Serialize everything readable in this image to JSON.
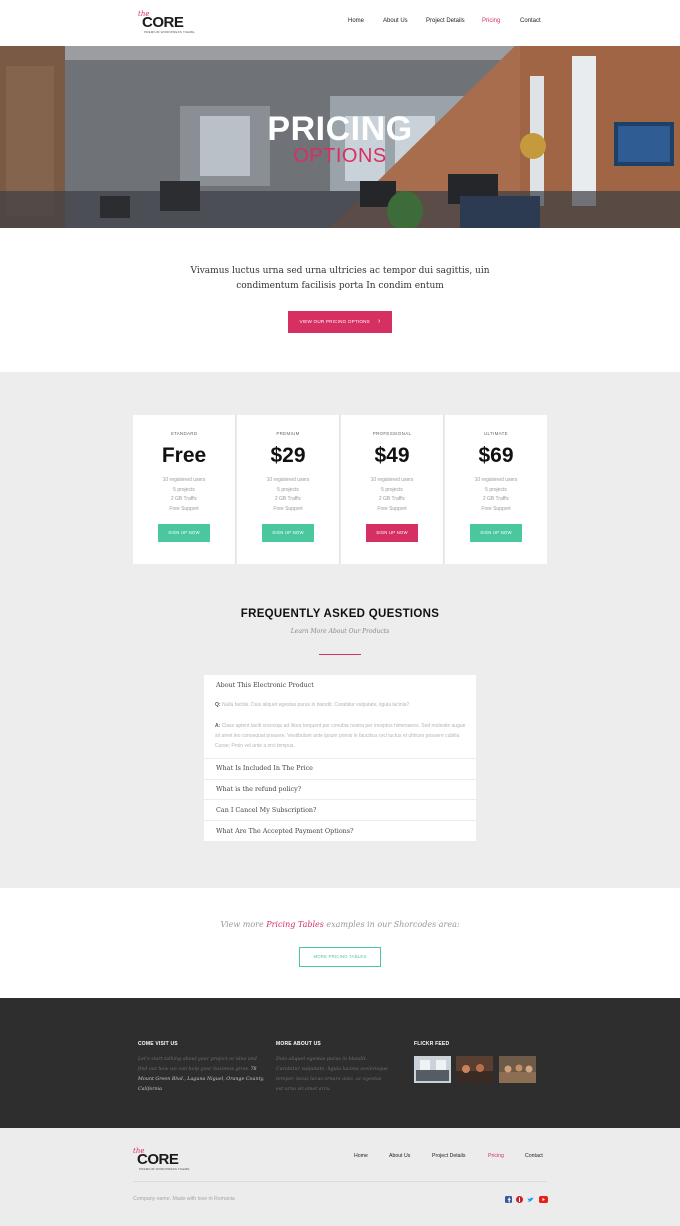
{
  "logo": {
    "prefix": "the",
    "name": "CORE",
    "tagline": "PREMIUM WORDPRESS THEME"
  },
  "nav": {
    "items": [
      "Home",
      "About Us",
      "Project Details",
      "Pricing",
      "Contact"
    ],
    "active": "Pricing"
  },
  "hero": {
    "title": "PRICING",
    "subtitle": "OPTIONS"
  },
  "intro": {
    "text": "Vivamus luctus urna sed urna ultricies ac tempor dui sagittis, uin condimentum facilisis porta In condim entum",
    "button": "VIEW OUR PRICING OPTIONS",
    "button_icon": "chevron-right-icon"
  },
  "plans": [
    {
      "name": "STANDARD",
      "price": "Free",
      "features": [
        "10 registered users",
        "5 projects",
        "2 GB Traffic",
        "Free Support"
      ],
      "button": "SIGN UP NOW",
      "highlight": false
    },
    {
      "name": "PREMIUM",
      "price": "$29",
      "features": [
        "10 registered users",
        "5 projects",
        "2 GB Traffic",
        "Free Support"
      ],
      "button": "SIGN UP NOW",
      "highlight": false
    },
    {
      "name": "PROFESSIONAL",
      "price": "$49",
      "features": [
        "10 registered users",
        "5 projects",
        "2 GB Traffic",
        "Free Support"
      ],
      "button": "SIGN UP NOW",
      "highlight": true
    },
    {
      "name": "ULTIMATE",
      "price": "$69",
      "features": [
        "10 registered users",
        "5 projects",
        "2 GB Traffic",
        "Free Support"
      ],
      "button": "SIGN UP NOW",
      "highlight": false
    }
  ],
  "faq": {
    "title": "FREQUENTLY ASKED QUESTIONS",
    "subtitle": "Learn More About Our Products",
    "open_question": "About This Electronic Product",
    "q_label": "Q:",
    "q_text": "Nulla facilisi. Duis aliquet egestas purus in blandit. Curabitur vulputate, ligula lacinia?",
    "a_label": "A:",
    "a_text": "Class aptent taciti sociosqu ad litora torquent per conubia nostra per inceptos himenaeos. Sed molestie augue sit amet leo consequat posuere. Vestibulum ante ipsum primis in faucibus orci luctus et ultrices posuere cubilia Curae; Proin vel ante a orci tempus.",
    "questions": [
      "What Is Included In The Price",
      "What is the refund policy?",
      "Can I Cancel My Subscription?",
      "What Are The Accepted Payment Options?"
    ]
  },
  "viewmore": {
    "text_before": "View more ",
    "link": "Pricing Tables",
    "text_after": " examples in our Shorcodes area:",
    "button": "MORE PRICING TABLES"
  },
  "footer": {
    "col1": {
      "title": "COME VISIT US",
      "text": "Let's start talking about your project or idea and find out how we can help your business grow. ",
      "address": "78 Mount Green Blvd., Laguna Niguel, Orange County, California"
    },
    "col2": {
      "title": "MORE ABOUT US",
      "text": "Duis aliquet egestas purus in blandit. Curabitur vulputate, ligula lacinia scelerisque tempor, lacus lacus ornare ante, ac egestas est urna sit amet arcu."
    },
    "col3": {
      "title": "FLICKR FEED"
    }
  },
  "bottom": {
    "copyright": "Company name. Made with love in Romania",
    "social": [
      "facebook-icon",
      "pinterest-icon",
      "twitter-icon",
      "youtube-icon"
    ]
  },
  "colors": {
    "accent": "#d63062",
    "green": "#4bc7a0",
    "dark": "#2e2e2e"
  }
}
